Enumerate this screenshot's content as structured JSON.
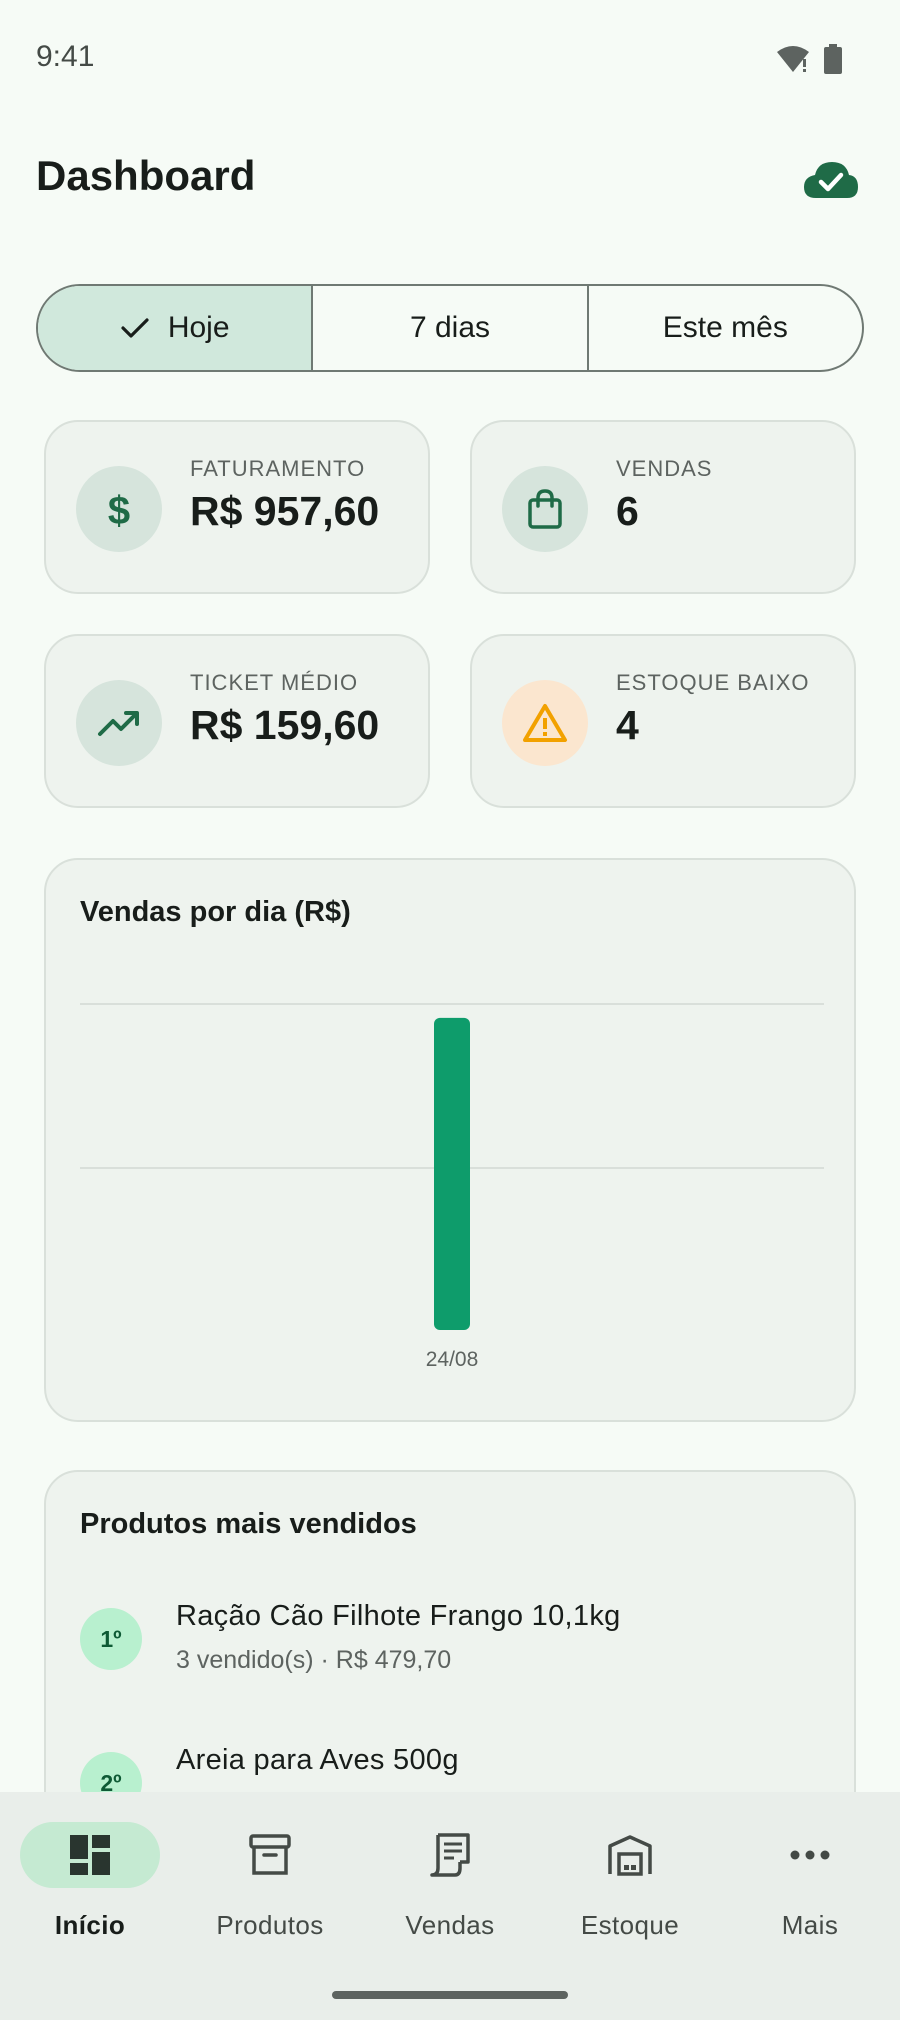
{
  "status_bar": {
    "time": "9:41"
  },
  "header": {
    "title": "Dashboard"
  },
  "period_filter": {
    "options": [
      {
        "label": "Hoje",
        "selected": true
      },
      {
        "label": "7 dias",
        "selected": false
      },
      {
        "label": "Este mês",
        "selected": false
      }
    ]
  },
  "stats": [
    {
      "label": "FATURAMENTO",
      "value": "R$ 957,60",
      "icon": "dollar-icon"
    },
    {
      "label": "VENDAS",
      "value": "6",
      "icon": "shopping-bag-icon"
    },
    {
      "label": "TICKET MÉDIO",
      "value": "R$ 159,60",
      "icon": "trending-up-icon"
    },
    {
      "label": "ESTOQUE BAIXO",
      "value": "4",
      "icon": "warning-icon"
    }
  ],
  "chart_card": {
    "title": "Vendas por dia (R$)"
  },
  "chart_data": {
    "type": "bar",
    "title": "Vendas por dia (R$)",
    "categories": [
      "24/08"
    ],
    "values": [
      957.6
    ],
    "ylim": [
      0,
      1000
    ],
    "grid": true,
    "bar_color": "#0e9c6b"
  },
  "top_products": {
    "title": "Produtos mais vendidos",
    "items": [
      {
        "rank": "1º",
        "name": "Ração Cão Filhote Frango 10,1kg",
        "meta": "3 vendido(s) · R$ 479,70"
      },
      {
        "rank": "2º",
        "name": "Areia para Aves 500g",
        "meta": ""
      }
    ]
  },
  "bottom_nav": {
    "items": [
      {
        "label": "Início",
        "icon": "dashboard-icon",
        "active": true
      },
      {
        "label": "Produtos",
        "icon": "archive-box-icon",
        "active": false
      },
      {
        "label": "Vendas",
        "icon": "receipt-icon",
        "active": false
      },
      {
        "label": "Estoque",
        "icon": "warehouse-icon",
        "active": false
      },
      {
        "label": "Mais",
        "icon": "more-horizontal-icon",
        "active": false
      }
    ]
  },
  "colors": {
    "accent": "#1f6b47",
    "bar": "#0e9c6b",
    "warning": "#f2a100",
    "background": "#f6fbf6"
  }
}
